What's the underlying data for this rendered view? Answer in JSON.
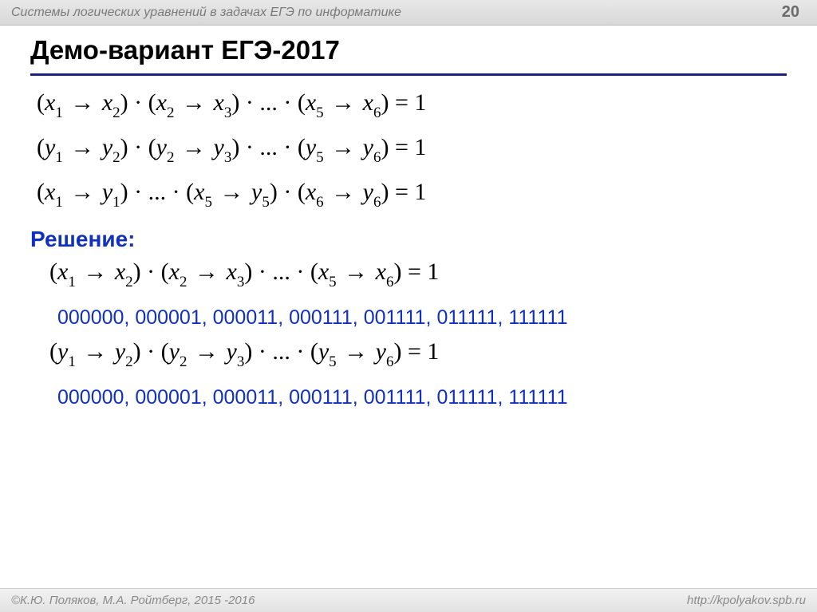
{
  "header": {
    "topic": "Системы логических уравнений в задачах ЕГЭ по информатике",
    "page_number": "20"
  },
  "title": "Демо-вариант ЕГЭ-2017",
  "equations": {
    "eq1": {
      "v": "x",
      "lhs_pairs": [
        [
          1,
          2
        ],
        [
          2,
          3
        ]
      ],
      "last_pair": [
        5,
        6
      ],
      "rhs": "1"
    },
    "eq2": {
      "v": "y",
      "lhs_pairs": [
        [
          1,
          2
        ],
        [
          2,
          3
        ]
      ],
      "last_pair": [
        5,
        6
      ],
      "rhs": "1"
    },
    "eq3": {
      "first": [
        1,
        1
      ],
      "mid": [
        5,
        5
      ],
      "last": [
        6,
        6
      ],
      "rhs": "1"
    },
    "eq4": {
      "v": "x",
      "lhs_pairs": [
        [
          1,
          2
        ],
        [
          2,
          3
        ]
      ],
      "last_pair": [
        5,
        6
      ],
      "rhs": "1"
    },
    "eq5": {
      "v": "y",
      "lhs_pairs": [
        [
          1,
          2
        ],
        [
          2,
          3
        ]
      ],
      "last_pair": [
        5,
        6
      ],
      "rhs": "1"
    }
  },
  "solution_label": "Решение:",
  "solutions": {
    "row1": "000000, 000001, 000011, 000111, 001111, 011111, 111111",
    "row2": "000000, 000001, 000011, 000111, 001111, 011111, 111111"
  },
  "footer": {
    "credit": "©К.Ю. Поляков, М.А. Ройтберг, 2015 -2016",
    "url": "http://kpolyakov.spb.ru"
  },
  "glyphs": {
    "arrow": "→",
    "dot": "·",
    "ellipsis": "..."
  }
}
